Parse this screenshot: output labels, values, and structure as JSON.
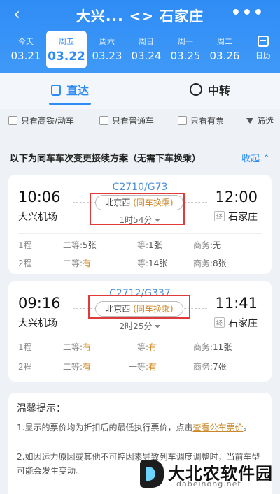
{
  "header": {
    "back_icon": "chevron-left-icon",
    "title": "大兴... <> 石家庄",
    "more_icon": "more-dots-icon",
    "calendar_label": "日历"
  },
  "dates": [
    {
      "weekday": "今天",
      "date": "03.21",
      "selected": false
    },
    {
      "weekday": "周五",
      "date": "03.22",
      "selected": true
    },
    {
      "weekday": "周六",
      "date": "03.23",
      "selected": false
    },
    {
      "weekday": "周日",
      "date": "03.24",
      "selected": false
    },
    {
      "weekday": "周一",
      "date": "03.25",
      "selected": false
    },
    {
      "weekday": "周二",
      "date": "03.26",
      "selected": false
    }
  ],
  "tabs": [
    {
      "label": "直达",
      "active": true
    },
    {
      "label": "中转",
      "active": false
    }
  ],
  "filters": [
    {
      "label": "只看高铁/动车"
    },
    {
      "label": "只看普通车"
    },
    {
      "label": "只看有票"
    }
  ],
  "filter_button": "筛选",
  "section": {
    "title": "以下为同车车次变更接续方案（无需下车换乘）",
    "collapse_label": "收起"
  },
  "trips": [
    {
      "train_no": "C2710/G73",
      "dep_time": "10:06",
      "dep_station": "大兴机场",
      "arr_time": "12:00",
      "arr_station": "石家庄",
      "end_tag": "终",
      "transfer_station": "北京西",
      "transfer_note": "(同车换乘)",
      "duration": "1时54分",
      "legs": [
        {
          "leg": "1程",
          "second_label": "二等:",
          "second": "5张",
          "first_label": "一等:",
          "first": "1张",
          "business_label": "商务:",
          "business": "无"
        },
        {
          "leg": "2程",
          "second_label": "二等:",
          "second": "有",
          "first_label": "一等:",
          "first": "14张",
          "business_label": "商务:",
          "business": "8张"
        }
      ]
    },
    {
      "train_no": "C2712/G337",
      "dep_time": "09:16",
      "dep_station": "大兴机场",
      "arr_time": "11:41",
      "arr_station": "石家庄",
      "end_tag": "终",
      "transfer_station": "北京西",
      "transfer_note": "(同车换乘)",
      "duration": "2时25分",
      "legs": [
        {
          "leg": "1程",
          "second_label": "二等:",
          "second": "有",
          "first_label": "一等:",
          "first": "有",
          "business_label": "商务:",
          "business": "11张"
        },
        {
          "leg": "2程",
          "second_label": "二等:",
          "second": "有",
          "first_label": "一等:",
          "first": "有",
          "business_label": "商务:",
          "business": "7张"
        }
      ]
    }
  ],
  "tips": {
    "title": "温馨提示：",
    "line1_prefix": "1.显示的票价均为折扣后的最低执行票价，点击",
    "line1_link": "查看公布票价",
    "line1_suffix": "。",
    "line2": "2.如因运力原因或其他不可控因素导致列车调度调整时，当前车型可能会发生变动。"
  },
  "watermark": {
    "name": "大北农软件园",
    "url": "dabeinong.net"
  },
  "colors": {
    "primary": "#2f8cf5",
    "highlight": "#c9882a",
    "red_box": "#e03a3a"
  }
}
